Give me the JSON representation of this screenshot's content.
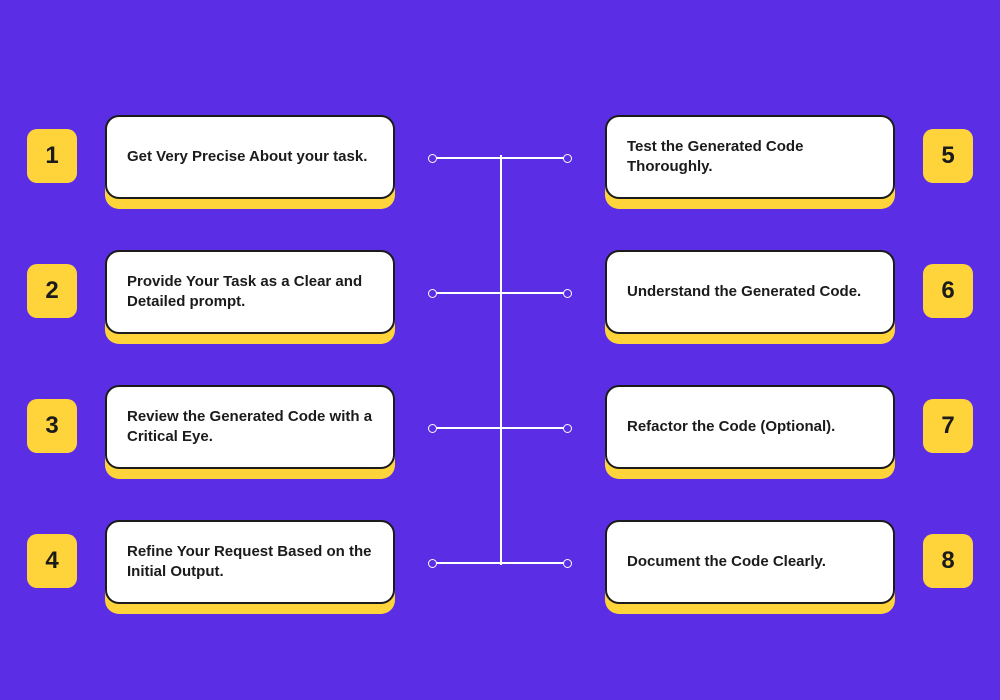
{
  "steps_left": [
    {
      "n": "1",
      "text": "Get Very Precise About your task."
    },
    {
      "n": "2",
      "text": "Provide Your Task as a Clear and Detailed prompt."
    },
    {
      "n": "3",
      "text": "Review the Generated Code with a Critical Eye."
    },
    {
      "n": "4",
      "text": "Refine Your Request Based on the Initial Output."
    }
  ],
  "steps_right": [
    {
      "n": "5",
      "text": "Test the Generated Code Thoroughly."
    },
    {
      "n": "6",
      "text": "Understand the Generated Code."
    },
    {
      "n": "7",
      "text": "Refactor the Code (Optional)."
    },
    {
      "n": "8",
      "text": "Document the Code Clearly."
    }
  ]
}
